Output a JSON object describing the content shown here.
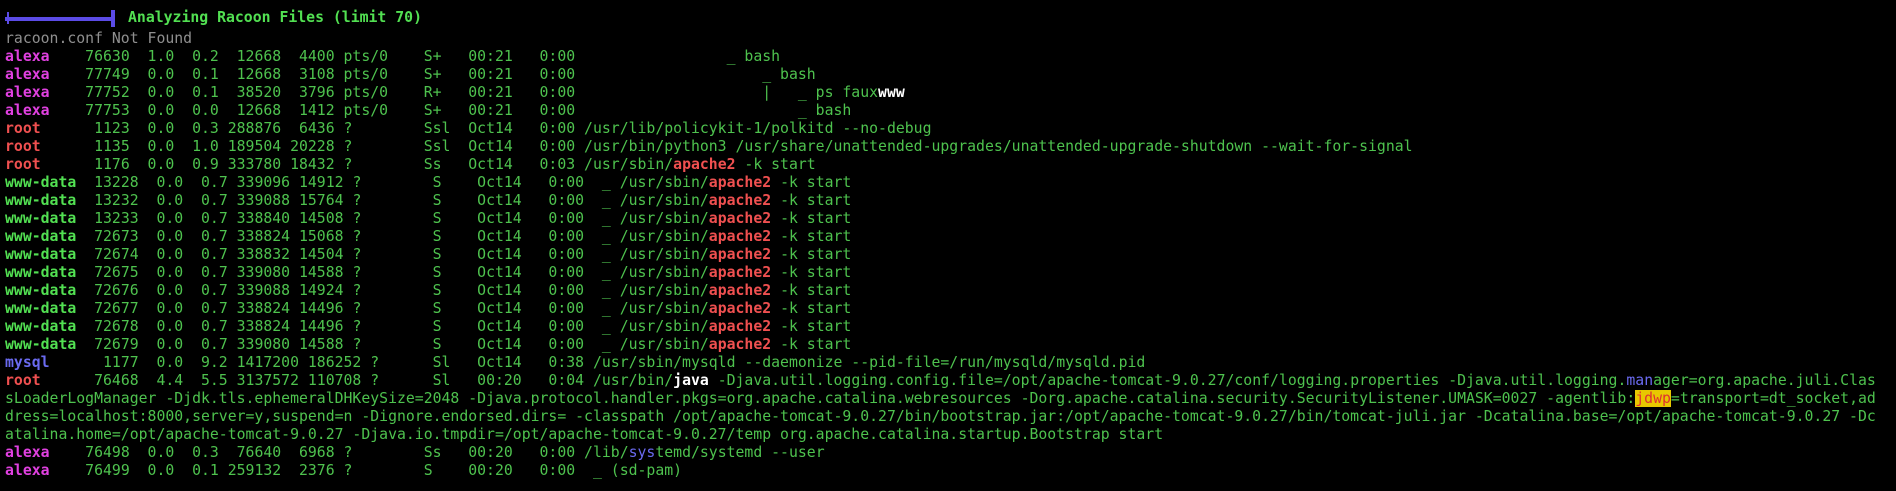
{
  "title": "Analyzing Racoon Files (limit 70)",
  "not_found": "racoon.conf Not Found",
  "rows": [
    {
      "user": "alexa",
      "ucls": "u-alexa",
      "rest": "    76630  1.0  0.2  12668  4400 pts/0    S+   00:21   0:00                 _ bash"
    },
    {
      "user": "alexa",
      "ucls": "u-alexa",
      "rest": "    77749  0.0  0.1  12668  3108 pts/0    S+   00:21   0:00                     _ bash"
    },
    {
      "user": "alexa",
      "ucls": "u-alexa",
      "rest": "    77752  0.0  0.1  38520  3796 pts/0    R+   00:21   0:00                     |   _ ps faux",
      "rest2": "www"
    },
    {
      "user": "alexa",
      "ucls": "u-alexa",
      "rest": "    77753  0.0  0.0  12668  1412 pts/0    S+   00:21   0:00                         _ bash"
    },
    {
      "user": "root",
      "ucls": "u-root",
      "rest": "      1123  0.0  0.3 288876  6436 ?        Ssl  Oct14   0:00 /usr/lib/policykit-1/polkitd --no-debug"
    },
    {
      "user": "root",
      "ucls": "u-root",
      "rest": "      1135  0.0  1.0 189504 20228 ?        Ssl  Oct14   0:00 /usr/bin/python3 /usr/share/unattended-upgrades/unattended-upgrade-shutdown --wait-for-signal"
    },
    {
      "user": "root",
      "ucls": "u-root",
      "rest": "      1176  0.0  0.9 333780 18432 ?        Ss   Oct14   0:03 /usr/sbin/",
      "red": "apache2",
      "tail": " -k start"
    },
    {
      "user": "www-data",
      "ucls": "u-www",
      "rest": "  13228  0.0  0.7 339096 14912 ?        S    Oct14   0:00  _ /usr/sbin/",
      "red": "apache2",
      "tail": " -k start"
    },
    {
      "user": "www-data",
      "ucls": "u-www",
      "rest": "  13232  0.0  0.7 339088 15764 ?        S    Oct14   0:00  _ /usr/sbin/",
      "red": "apache2",
      "tail": " -k start"
    },
    {
      "user": "www-data",
      "ucls": "u-www",
      "rest": "  13233  0.0  0.7 338840 14508 ?        S    Oct14   0:00  _ /usr/sbin/",
      "red": "apache2",
      "tail": " -k start"
    },
    {
      "user": "www-data",
      "ucls": "u-www",
      "rest": "  72673  0.0  0.7 338824 15068 ?        S    Oct14   0:00  _ /usr/sbin/",
      "red": "apache2",
      "tail": " -k start"
    },
    {
      "user": "www-data",
      "ucls": "u-www",
      "rest": "  72674  0.0  0.7 338832 14504 ?        S    Oct14   0:00  _ /usr/sbin/",
      "red": "apache2",
      "tail": " -k start"
    },
    {
      "user": "www-data",
      "ucls": "u-www",
      "rest": "  72675  0.0  0.7 339080 14588 ?        S    Oct14   0:00  _ /usr/sbin/",
      "red": "apache2",
      "tail": " -k start"
    },
    {
      "user": "www-data",
      "ucls": "u-www",
      "rest": "  72676  0.0  0.7 339088 14924 ?        S    Oct14   0:00  _ /usr/sbin/",
      "red": "apache2",
      "tail": " -k start"
    },
    {
      "user": "www-data",
      "ucls": "u-www",
      "rest": "  72677  0.0  0.7 338824 14496 ?        S    Oct14   0:00  _ /usr/sbin/",
      "red": "apache2",
      "tail": " -k start"
    },
    {
      "user": "www-data",
      "ucls": "u-www",
      "rest": "  72678  0.0  0.7 338824 14496 ?        S    Oct14   0:00  _ /usr/sbin/",
      "red": "apache2",
      "tail": " -k start"
    },
    {
      "user": "www-data",
      "ucls": "u-www",
      "rest": "  72679  0.0  0.7 339080 14588 ?        S    Oct14   0:00  _ /usr/sbin/",
      "red": "apache2",
      "tail": " -k start"
    },
    {
      "user": "mysql",
      "ucls": "u-mysql",
      "rest": "      1177  0.0  9.2 1417200 186252 ?      Sl   Oct14   0:38 /usr/sbin/mysqld --daemonize --pid-file=/run/mysqld/mysqld.pid"
    }
  ],
  "java": {
    "l1_user": "root",
    "l1_a": "      76468  4.4  5.5 3137572 110708 ?      Sl   00:20   0:04 /usr/bin/",
    "l1_java": "java",
    "l1_b": " -Djava.util.logging.config.file=/opt/apache-tomcat-9.0.27/conf/logging.properties -Djava.util.logging.",
    "l1_man": "man",
    "l1_c": "ager=org.apache.juli.Clas",
    "l2_a": "sLoaderLogManager -Djdk.tls.ephemeralDHKeySize=2048 -Djava.protocol.handler.pkgs=org.apache.catalina.webresources -Dorg.apache.catalina.security.SecurityListener.UMASK=0027 -agentlib:",
    "l2_hl": "jdwp",
    "l2_b": "=transport=dt_socket,ad",
    "l3": "dress=localhost:8000,server=y,suspend=n -Dignore.endorsed.dirs= -classpath /opt/apache-tomcat-9.0.27/bin/bootstrap.jar:/opt/apache-tomcat-9.0.27/bin/tomcat-juli.jar -Dcatalina.base=/opt/apache-tomcat-9.0.27 -Dc",
    "l4": "atalina.home=/opt/apache-tomcat-9.0.27 -Djava.io.tmpdir=/opt/apache-tomcat-9.0.27/temp org.apache.catalina.startup.Bootstrap start"
  },
  "tail_rows": {
    "r1_user": "alexa",
    "r1_a": "    76498  0.0  0.3  76640  6968 ?        Ss   00:20   0:00 /lib/",
    "r1_sys": "sys",
    "r1_b": "temd/systemd --user",
    "r2_user": "alexa",
    "r2_a": "    76499  0.0  0.1 259132  2376 ?        S    00:20   0:00  _ (sd-pam)"
  }
}
